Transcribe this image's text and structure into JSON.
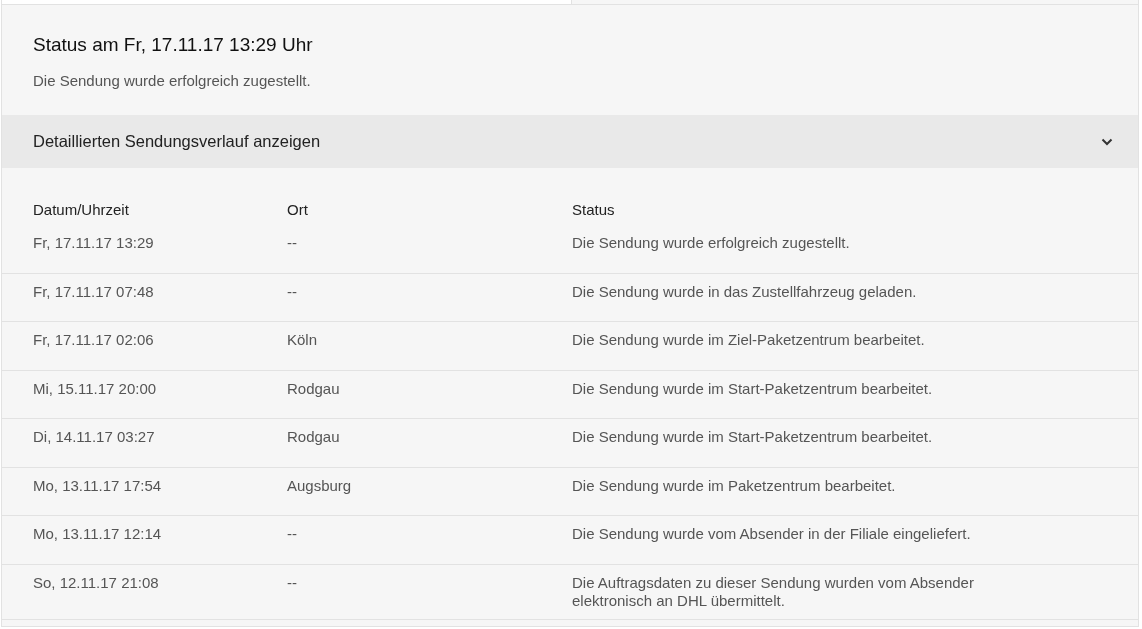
{
  "status": {
    "title": "Status am Fr, 17.11.17 13:29 Uhr",
    "message": "Die Sendung wurde erfolgreich zugestellt."
  },
  "history_toggle": {
    "label": "Detaillierten Sendungsverlauf anzeigen",
    "expanded": true
  },
  "table": {
    "columns": [
      "Datum/Uhrzeit",
      "Ort",
      "Status"
    ],
    "rows": [
      {
        "date": "Fr, 17.11.17 13:29",
        "place": "--",
        "status": "Die Sendung wurde erfolgreich zugestellt."
      },
      {
        "date": "Fr, 17.11.17 07:48",
        "place": "--",
        "status": "Die Sendung wurde in das Zustellfahrzeug geladen."
      },
      {
        "date": "Fr, 17.11.17 02:06",
        "place": "Köln",
        "status": "Die Sendung wurde im Ziel-Paketzentrum bearbeitet."
      },
      {
        "date": "Mi, 15.11.17 20:00",
        "place": "Rodgau",
        "status": "Die Sendung wurde im Start-Paketzentrum bearbeitet."
      },
      {
        "date": "Di, 14.11.17 03:27",
        "place": "Rodgau",
        "status": "Die Sendung wurde im Start-Paketzentrum bearbeitet."
      },
      {
        "date": "Mo, 13.11.17 17:54",
        "place": "Augsburg",
        "status": "Die Sendung wurde im Paketzentrum bearbeitet."
      },
      {
        "date": "Mo, 13.11.17 12:14",
        "place": "--",
        "status": "Die Sendung wurde vom Absender in der Filiale eingeliefert."
      },
      {
        "date": "So, 12.11.17 21:08",
        "place": "--",
        "status": "Die Auftragsdaten zu dieser Sendung wurden vom Absender elektronisch an DHL übermittelt."
      }
    ]
  }
}
